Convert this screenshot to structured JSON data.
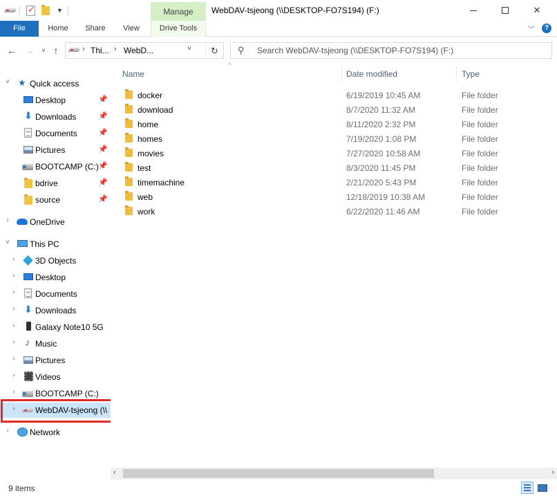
{
  "titlebar": {
    "manage_label": "Manage",
    "window_title": "WebDAV-tsjeong (\\\\DESKTOP-FO7S194) (F:)",
    "minimize": "—",
    "maximize": "☐",
    "close": "✕"
  },
  "ribbon": {
    "tabs": [
      "File",
      "Home",
      "Share",
      "View",
      "Drive Tools"
    ],
    "expand_icon": "chevron-down",
    "help_glyph": "?"
  },
  "address": {
    "crumbs": [
      "Thi...",
      "WebD..."
    ],
    "back": "←",
    "forward": "→",
    "up": "↑",
    "recent": "˅",
    "refresh": "↻",
    "dropdown": "˅"
  },
  "search": {
    "placeholder": "Search WebDAV-tsjeong (\\\\DESKTOP-FO7S194) (F:)"
  },
  "navpane": {
    "quick_access": "Quick access",
    "quick_items": [
      {
        "label": "Desktop",
        "icon": "desktop-icon"
      },
      {
        "label": "Downloads",
        "icon": "download-icon"
      },
      {
        "label": "Documents",
        "icon": "document-icon"
      },
      {
        "label": "Pictures",
        "icon": "pictures-icon"
      },
      {
        "label": "BOOTCAMP (C:)",
        "icon": "drive-icon"
      },
      {
        "label": "bdrive",
        "icon": "folder-icon"
      },
      {
        "label": "source",
        "icon": "folder-icon"
      }
    ],
    "onedrive": "OneDrive",
    "this_pc": "This PC",
    "pc_items": [
      {
        "label": "3D Objects",
        "icon": "3d-objects-icon"
      },
      {
        "label": "Desktop",
        "icon": "desktop-icon"
      },
      {
        "label": "Documents",
        "icon": "document-icon"
      },
      {
        "label": "Downloads",
        "icon": "download-icon"
      },
      {
        "label": "Galaxy Note10 5G",
        "icon": "phone-icon"
      },
      {
        "label": "Music",
        "icon": "music-icon"
      },
      {
        "label": "Pictures",
        "icon": "pictures-icon"
      },
      {
        "label": "Videos",
        "icon": "videos-icon"
      },
      {
        "label": "BOOTCAMP (C:)",
        "icon": "drive-icon"
      },
      {
        "label": "WebDAV-tsjeong (\\\\",
        "icon": "network-drive-icon",
        "selected": true
      }
    ],
    "network": "Network"
  },
  "content": {
    "columns": [
      "Name",
      "Date modified",
      "Type"
    ],
    "rows": [
      {
        "name": "docker",
        "date": "6/19/2019 10:45 AM",
        "type": "File folder"
      },
      {
        "name": "download",
        "date": "8/7/2020 11:32 AM",
        "type": "File folder"
      },
      {
        "name": "home",
        "date": "8/11/2020 2:32 PM",
        "type": "File folder"
      },
      {
        "name": "homes",
        "date": "7/19/2020 1:08 PM",
        "type": "File folder"
      },
      {
        "name": "movies",
        "date": "7/27/2020 10:58 AM",
        "type": "File folder"
      },
      {
        "name": "test",
        "date": "8/3/2020 11:45 PM",
        "type": "File folder"
      },
      {
        "name": "timemachine",
        "date": "2/21/2020 5:43 PM",
        "type": "File folder"
      },
      {
        "name": "web",
        "date": "12/18/2019 10:38 AM",
        "type": "File folder"
      },
      {
        "name": "work",
        "date": "6/22/2020 11:46 AM",
        "type": "File folder"
      }
    ]
  },
  "status": {
    "items_count": "9 items"
  },
  "colors": {
    "file_tab": "#1f6fbf",
    "manage_tab": "#d5eec5",
    "selected_row": "#cce4f7",
    "highlight_box": "#e02a2a",
    "column_header": "#4c607a"
  }
}
